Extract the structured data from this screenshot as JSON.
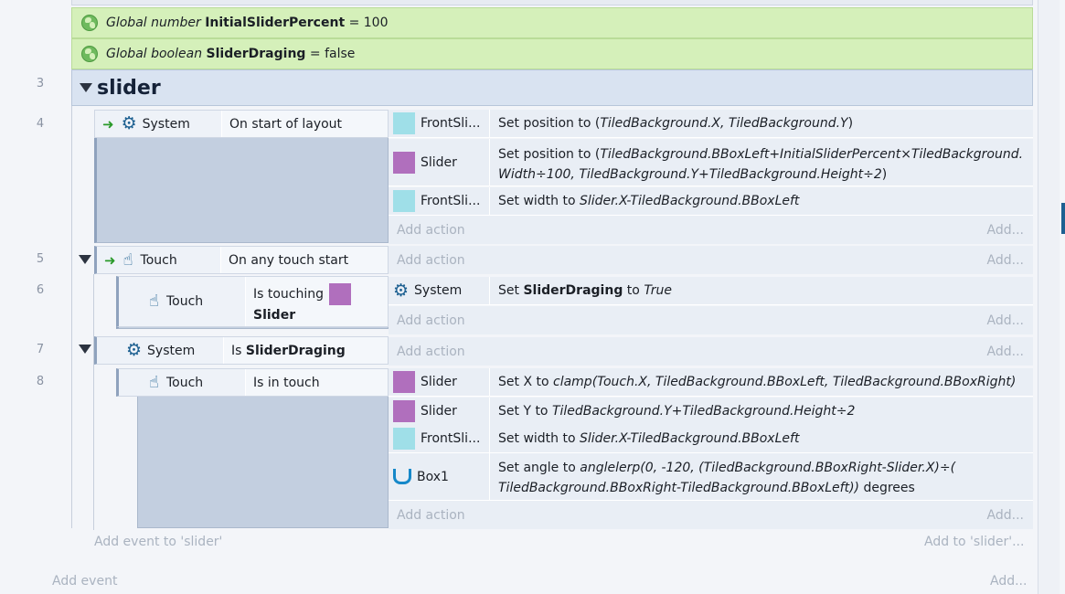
{
  "globals": [
    {
      "type_label": "Global number",
      "name": "InitialSliderPercent",
      "value": "= 100"
    },
    {
      "type_label": "Global boolean",
      "name": "SliderDraging",
      "value": "= false"
    }
  ],
  "group": {
    "line": "3",
    "title": "slider"
  },
  "events": {
    "e4": {
      "line": "4",
      "cond_object": "System",
      "cond_text": "On start of layout",
      "actions": [
        {
          "object": "FrontSli...",
          "text": "Set position to (TiledBackground.X, TiledBackground.Y)"
        },
        {
          "object": "Slider",
          "text_line1": "Set position to (TiledBackground.BBoxLeft+InitialSliderPercent×TiledBackground.",
          "text_line2": "Width÷100, TiledBackground.Y+TiledBackground.Height÷2)"
        },
        {
          "object": "FrontSli...",
          "text": "Set width to Slider.X-TiledBackground.BBoxLeft"
        }
      ]
    },
    "e5": {
      "line": "5",
      "cond_object": "Touch",
      "cond_text": "On any touch start"
    },
    "e6": {
      "line": "6",
      "cond_object": "Touch",
      "cond_text": "Is touching",
      "cond_target": "Slider",
      "action_object": "System",
      "action_prefix": "Set",
      "action_var": "SliderDraging",
      "action_mid": "to",
      "action_value": "True"
    },
    "e7": {
      "line": "7",
      "cond_object": "System",
      "cond_prefix": "Is",
      "cond_var": "SliderDraging"
    },
    "e8": {
      "line": "8",
      "cond_object": "Touch",
      "cond_text": "Is in touch",
      "actions": [
        {
          "object": "Slider",
          "prefix": "Set X to",
          "expr": "clamp(Touch.X, TiledBackground.BBoxLeft, TiledBackground.BBoxRight)"
        },
        {
          "object": "Slider",
          "prefix": "Set Y to",
          "expr": "TiledBackground.Y+TiledBackground.Height÷2"
        },
        {
          "object": "FrontSli...",
          "prefix": "Set width to",
          "expr": "Slider.X-TiledBackground.BBoxLeft"
        },
        {
          "object": "Box1",
          "prefix": "Set angle to",
          "expr1": "anglelerp(0, -120, (TiledBackground.BBoxRight-Slider.X)÷(",
          "expr2": "TiledBackground.BBoxRight-TiledBackground.BBoxLeft))",
          "suffix": "degrees"
        }
      ]
    }
  },
  "labels": {
    "add_action": "Add action",
    "add_short": "Add...",
    "add_event_slider": "Add event to 'slider'",
    "add_to_slider": "Add to 'slider'...",
    "add_event": "Add event"
  },
  "colors": {
    "global_bg": "#d5f0ba",
    "group_bg": "#d9e3f1",
    "accent": "#1d6091",
    "sprite_cyan": "#9fdfe8",
    "sprite_purple": "#b06fbd"
  },
  "icons": {
    "global": "globe-icon",
    "system": "gear-icon",
    "touch": "hand-pointer-icon",
    "trigger": "trigger-arrow-icon",
    "box1": "box-u-icon",
    "collapse": "triangle-down-icon"
  }
}
